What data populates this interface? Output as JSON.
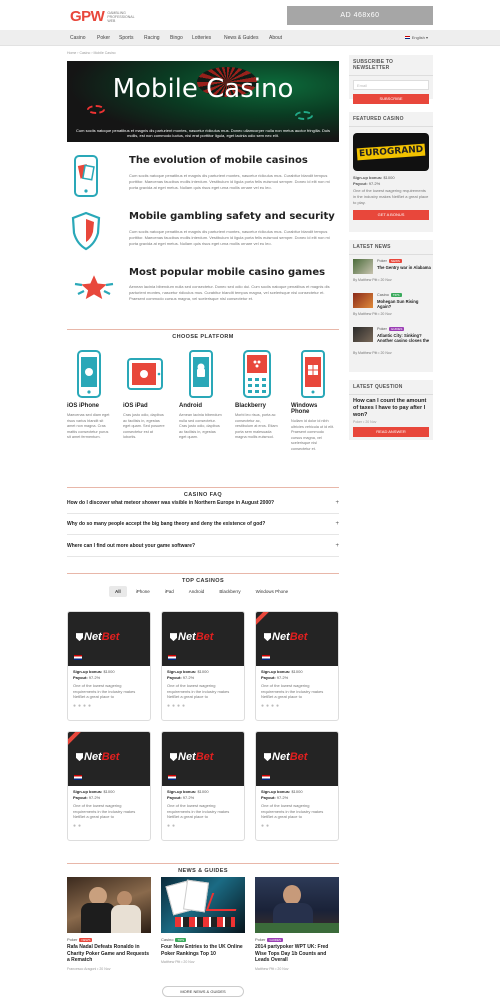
{
  "header": {
    "logo": "GPW",
    "logo_sub": "Gambling Professional Web",
    "ad": "AD 468x60"
  },
  "nav": {
    "items": [
      "Casino",
      "Poker",
      "Sports",
      "Racing",
      "Bingo",
      "Lotteries",
      "News & Guides",
      "About"
    ],
    "language": "English"
  },
  "breadcrumb": "Home › Casino › Mobile Casino",
  "hero": {
    "title": "Mobile Casino",
    "text": "Cum sociis natoque penatibus et magnis dis parturient montes, nascetur ridiculus mus. Donec ullamcorper nulla non metus auctor fringilla. Duis mollis, est non commodo luctus, nisi erat porttitor ligula, eget lacinia odio sem nec elit."
  },
  "features": [
    {
      "title": "The evolution of mobile casinos",
      "text": "Cum sociis natoque penatibus et magnis dis parturient montes, nascetur ridiculus mus. Curabitur blandit tempus porttitor. Maecenas faucibus mollis interdum. Vestibulum id ligula porta felis euismod semper. Donec id elit non mi porta gravida at eget metus. Nullam quis risus eget urna mollis ornare vel eu leo.",
      "icon": "mobile-cards-icon"
    },
    {
      "title": "Mobile gambling safety and security",
      "text": "Cum sociis natoque penatibus et magnis dis parturient montes, nascetur ridiculus mus. Curabitur blandit tempus porttitor. Maecenas faucibus mollis interdum. Vestibulum id ligula porta felis euismod semper. Donec id elit non mi porta gravida at eget metus. Nullam quis risus eget urna mollis ornare vel eu leo.",
      "icon": "shield-icon"
    },
    {
      "title": "Most popular mobile casino games",
      "text": "Aenean lacinia bibendum nulla sed consectetur. Donec sed odio dui. Cum sociis natoque penatibus et magnis dis parturient montes, nascetur ridiculus mus. Curabitur blandit tempus magna, vel scelerisque nisl consectetur et. Praesent commodo cursus magna, vel scelerisque nisl consectetur et.",
      "icon": "star-icon"
    }
  ],
  "platform": {
    "heading": "CHOOSE PLATFORM",
    "items": [
      {
        "name": "iOS iPhone",
        "text": "Maecenas sed diam eget risus varius blandit sit amet non magna. Cras mattis consectetur purus sit amet fermentum."
      },
      {
        "name": "iOS iPad",
        "text": "Cras justo odio, dapibus ac facilisis in, egestas eget quam. Sed posuere consectetur est at lobortis."
      },
      {
        "name": "Android",
        "text": "Aenean lacinia bibendum nulla sed consectetur. Cras justo odio, dapibus ac facilisis in, egestas eget quam."
      },
      {
        "name": "Blackberry",
        "text": "Morbi leo risus, porta ac consectetur ac, vestibulum at eros. Etiam porta sem malesuada magna mollis euismod."
      },
      {
        "name": "Windows Phone",
        "text": "Nullam id dolor id nibh ultricies vehicula ut id elit. Praesent commodo cursus magna, vel scelerisque nisl consectetur et."
      }
    ]
  },
  "faq": {
    "heading": "CASINO FAQ",
    "items": [
      "How do I discover what meteor shower was visible in Northern Europe in August 2000?",
      "Why do so many people accept the big bang theory and deny the existence of god?",
      "Where can I find out more about your game software?"
    ]
  },
  "top_casinos": {
    "heading": "TOP CASINOS",
    "filters": [
      "All",
      "iPhone",
      "iPad",
      "Android",
      "Blackberry",
      "Windows Phone"
    ],
    "card": {
      "brand_a": "Net",
      "brand_b": "Bet",
      "bonus_label": "Sign-up bonus:",
      "bonus": "$1000",
      "payout_label": "Payout:",
      "payout": "97.2%",
      "desc": "One of the lowest wagering requirements in the industry makes NetBet a great place to"
    }
  },
  "news": {
    "heading": "NEWS & GUIDES",
    "items": [
      {
        "cat": "Poker",
        "badge": "NEWS",
        "badge_color": "#e8473b",
        "title": "Rafa Nadal Defeats Ronaldo in Charity Poker Game and Requests a Rematch",
        "meta": "Francesco Aragoni • 20 Nov"
      },
      {
        "cat": "Casino",
        "badge": "TIPS",
        "badge_color": "#3aaa5c",
        "title": "Four New Entries to the UK Online Poker Rankings Top 10",
        "meta": "Matthew Pitt • 20 Nov"
      },
      {
        "cat": "Poker",
        "badge": "GUIDES",
        "badge_color": "#9b3fb5",
        "title": "2014 partypoker WPT UK: Fred Wise Tops Day 1b Counts and Leads Overall",
        "meta": "Matthew Pitt • 20 Nov"
      }
    ],
    "more": "MORE NEWS & GUIDES"
  },
  "sidebar": {
    "newsletter": {
      "title": "SUBSCRIBE TO NEWSLETTER",
      "placeholder": "Email",
      "button": "SUBSCRIBE"
    },
    "featured": {
      "title": "FEATURED CASINO",
      "logo": "EUROGRAND",
      "bonus_label": "Sign-up bonus:",
      "bonus": "$1000",
      "payout_label": "Payout:",
      "payout": "97.2%",
      "text": "One of the lowest wagering requirements in the industry makes NetBet a great place to play.",
      "button": "GET A BONUS"
    },
    "latest_news": {
      "title": "LATEST NEWS",
      "items": [
        {
          "cat": "Poker",
          "badge": "NEWS",
          "badge_color": "#e8473b",
          "title": "The Gentry war in Alabama",
          "meta": "By Matthew Pitt • 20 Nov"
        },
        {
          "cat": "Casino",
          "badge": "TIPS",
          "badge_color": "#3aaa5c",
          "title": "Mohegan Sun Rising Again?",
          "meta": "By Matthew Pitt • 20 Nov"
        },
        {
          "cat": "Poker",
          "badge": "GUIDES",
          "badge_color": "#9b3fb5",
          "title": "Atlantic City: Sinking? Another casino closes the",
          "meta": "By Matthew Pitt • 20 Nov"
        }
      ]
    },
    "latest_question": {
      "title": "LATEST QUESTION",
      "question": "How can I count the amount of taxes I have to pay after I won?",
      "meta": "Poker • 20 Nov",
      "button": "READ ANSWER"
    }
  }
}
